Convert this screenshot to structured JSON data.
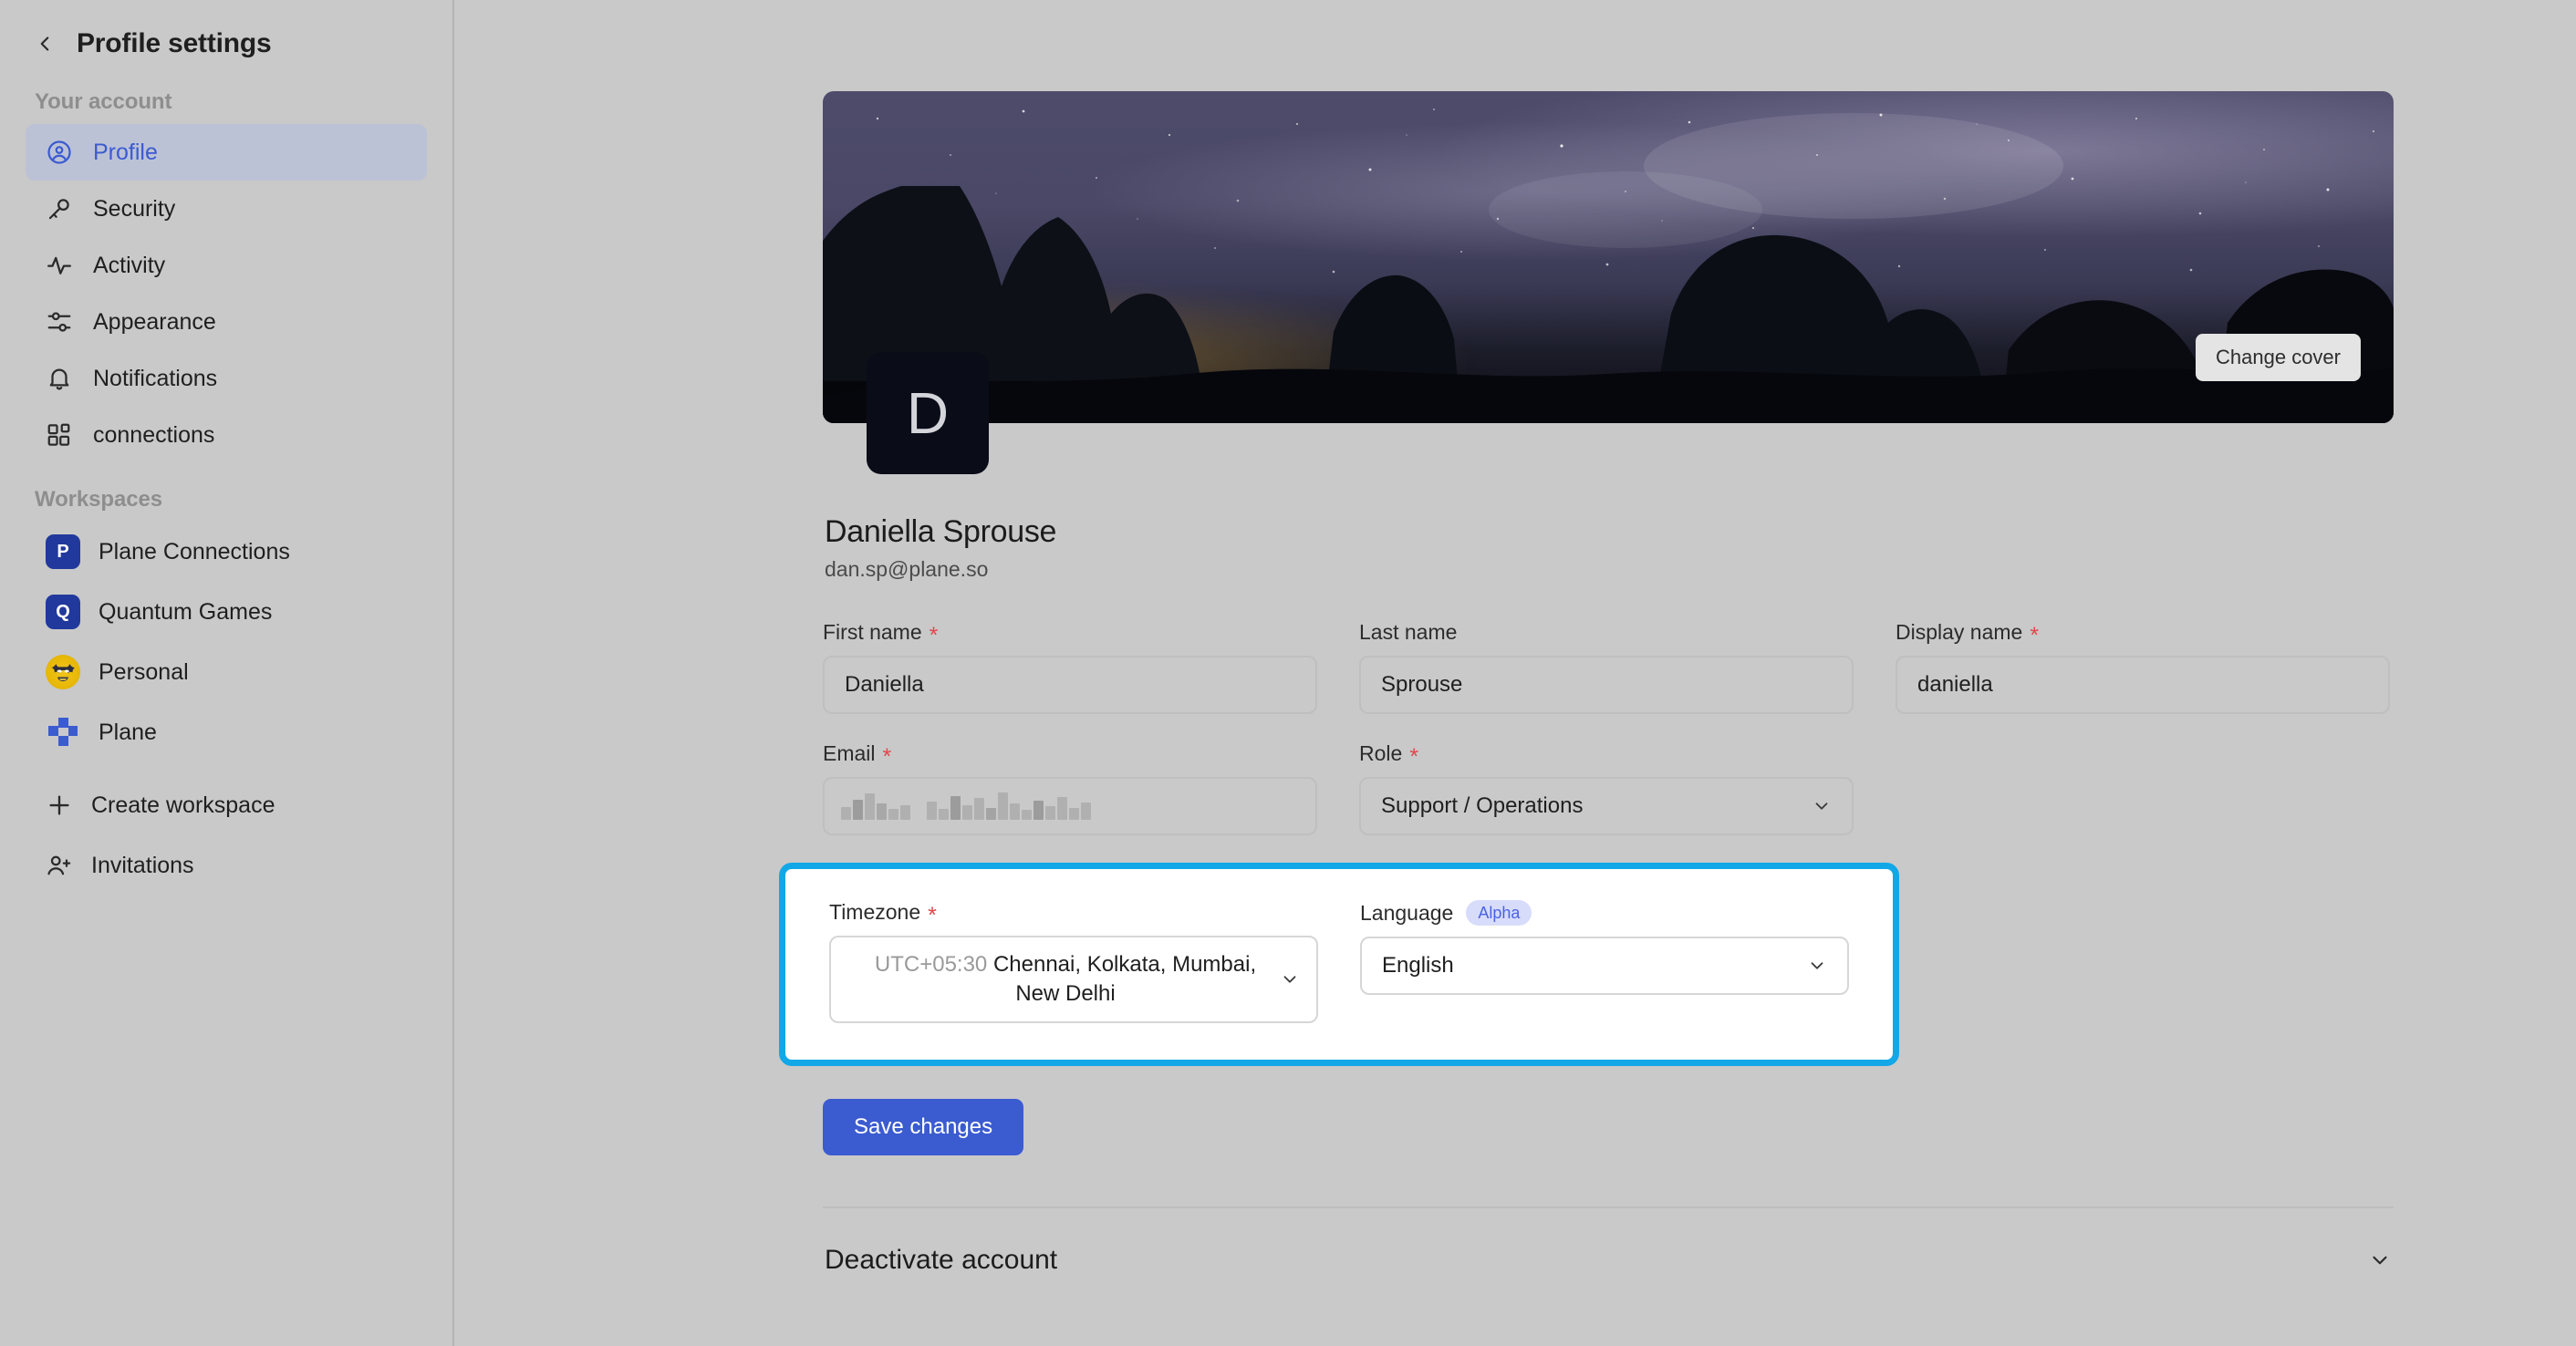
{
  "sidebar": {
    "back_icon": "chevron-left-icon",
    "title": "Profile settings",
    "account_section_label": "Your account",
    "account_items": [
      {
        "label": "Profile",
        "icon": "user-circle-icon",
        "active": true
      },
      {
        "label": "Security",
        "icon": "key-icon",
        "active": false
      },
      {
        "label": "Activity",
        "icon": "activity-pulse-icon",
        "active": false
      },
      {
        "label": "Appearance",
        "icon": "sliders-icon",
        "active": false
      },
      {
        "label": "Notifications",
        "icon": "bell-icon",
        "active": false
      },
      {
        "label": "connections",
        "icon": "grid-blocks-icon",
        "active": false
      }
    ],
    "workspaces_section_label": "Workspaces",
    "workspaces": [
      {
        "label": "Plane Connections",
        "initial": "P",
        "badge_color": "#21399c",
        "badge_type": "letter"
      },
      {
        "label": "Quantum Games",
        "initial": "Q",
        "badge_color": "#21399c",
        "badge_type": "letter"
      },
      {
        "label": "Personal",
        "initial": "",
        "badge_color": "#e8b807",
        "badge_type": "avatar-image"
      },
      {
        "label": "Plane",
        "initial": "",
        "badge_color": "#3b5bd0",
        "badge_type": "plane-logo"
      }
    ],
    "create_workspace_label": "Create workspace",
    "create_workspace_icon": "plus-icon",
    "invitations_label": "Invitations",
    "invitations_icon": "user-plus-icon"
  },
  "cover": {
    "change_cover_label": "Change cover",
    "description": "night sky with milky way over dark tree silhouettes"
  },
  "profile": {
    "avatar_initial": "D",
    "avatar_bg": "#0a0c18",
    "name": "Daniella Sprouse",
    "email": "dan.sp@plane.so"
  },
  "form": {
    "first_name": {
      "label": "First name",
      "required": true,
      "value": "Daniella"
    },
    "last_name": {
      "label": "Last name",
      "required": false,
      "value": "Sprouse"
    },
    "display_name": {
      "label": "Display name",
      "required": true,
      "value": "daniella"
    },
    "email": {
      "label": "Email",
      "required": true,
      "value": "",
      "redacted": true
    },
    "role": {
      "label": "Role",
      "required": true,
      "value": "Support / Operations",
      "icon": "chevron-down-icon"
    },
    "timezone": {
      "label": "Timezone",
      "required": true,
      "offset": "UTC+05:30",
      "value": "Chennai, Kolkata, Mumbai, New Delhi",
      "icon": "chevron-down-icon"
    },
    "language": {
      "label": "Language",
      "badge": "Alpha",
      "value": "English",
      "icon": "chevron-down-icon"
    },
    "save_label": "Save changes"
  },
  "deactivate": {
    "title": "Deactivate account",
    "icon": "chevron-down-icon"
  },
  "colors": {
    "accent_blue": "#3b5bd0",
    "highlight_border": "#12a8e8",
    "required_red": "#e0474c",
    "alpha_badge_bg": "#d8dcfb",
    "alpha_badge_text": "#4a63e0",
    "page_bg": "#c9c9c9"
  }
}
